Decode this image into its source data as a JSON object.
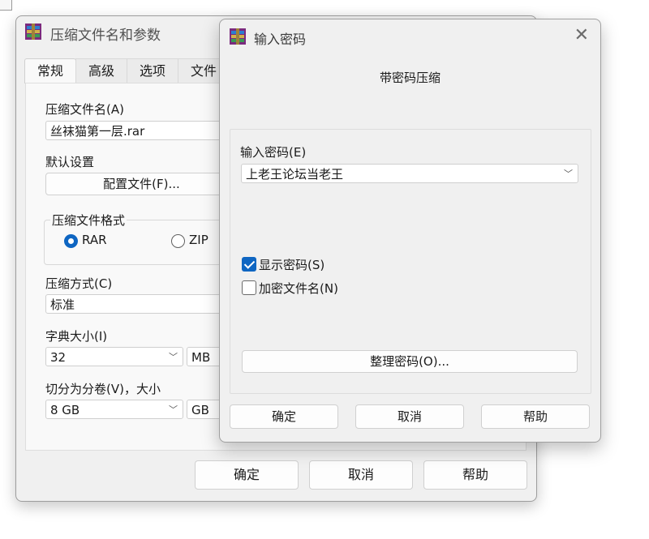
{
  "main_dialog": {
    "title": "压缩文件名和参数",
    "tabs": [
      "常规",
      "高级",
      "选项",
      "文件"
    ],
    "archive_name_label": "压缩文件名(A)",
    "archive_name_value": "丝袜猫第一层.rar",
    "default_settings_label": "默认设置",
    "profiles_button": "配置文件(F)...",
    "format_group_label": "压缩文件格式",
    "format_options": [
      {
        "label": "RAR",
        "selected": true
      },
      {
        "label": "ZIP",
        "selected": false
      }
    ],
    "method_label": "压缩方式(C)",
    "method_value": "标准",
    "dict_label": "字典大小(I)",
    "dict_value": "32",
    "dict_unit": "MB",
    "split_label": "切分为分卷(V)，大小",
    "split_value": "8 GB",
    "split_unit": "GB",
    "ok_button": "确定",
    "cancel_button": "取消",
    "help_button": "帮助"
  },
  "password_dialog": {
    "title": "输入密码",
    "header": "带密码压缩",
    "enter_password_label": "输入密码(E)",
    "password_value": "上老王论坛当老王",
    "show_password": {
      "label": "显示密码(S)",
      "checked": true
    },
    "encrypt_names": {
      "label": "加密文件名(N)",
      "checked": false
    },
    "organize_button": "整理密码(O)...",
    "ok_button": "确定",
    "cancel_button": "取消",
    "help_button": "帮助"
  },
  "colors": {
    "accent": "#0f66c2",
    "dialog_bg": "#f0f0f0"
  },
  "icons": [
    "winrar-icon",
    "close-icon",
    "chevron-down-icon",
    "radio-icon",
    "checkbox-icon"
  ]
}
